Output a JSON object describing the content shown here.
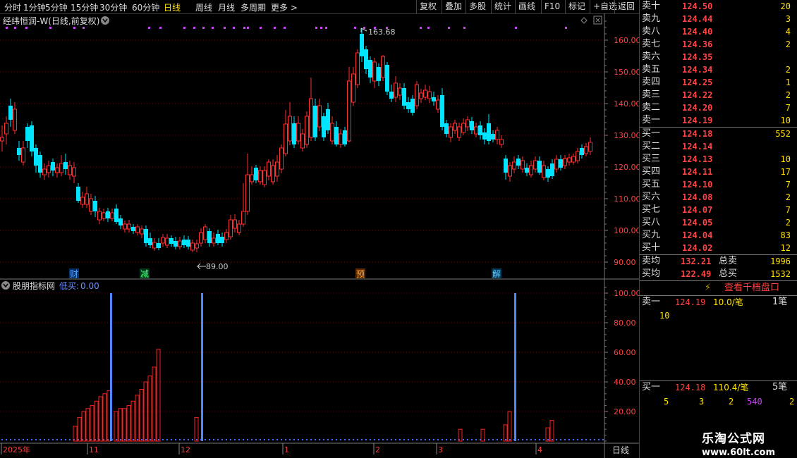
{
  "toolbar": {
    "periods": [
      "分时",
      "1分钟",
      "5分钟",
      "15分钟",
      "30分钟",
      "60分钟",
      "日线",
      "周线",
      "月线",
      "多周期",
      "更多 >"
    ],
    "active": "日线",
    "right_buttons": [
      "复权",
      "叠加",
      "多股",
      "统计",
      "画线",
      "F10",
      "标记",
      "+自选",
      "返回"
    ]
  },
  "chart_title": "经纬恒润-W(日线,前复权)",
  "price_axis": [
    "160.00",
    "150.00",
    "140.00",
    "130.00",
    "120.00",
    "110.00",
    "100.00",
    "90.00"
  ],
  "peak_label": "163.68",
  "low_label": "89.00",
  "event_markers": [
    "财",
    "减",
    "预",
    "解"
  ],
  "indicator": {
    "name": "股朋指标网",
    "label": "低买:",
    "value": "0.00"
  },
  "indicator_axis": [
    "100.00",
    "80.00",
    "60.00",
    "40.00",
    "20.00"
  ],
  "date_axis": [
    "2025年",
    "11",
    "12",
    "1",
    "2",
    "3",
    "4"
  ],
  "period_label": "日线",
  "colors": {
    "up": "#ff3030",
    "down": "#00e5ff",
    "signal": "#4f86ff",
    "bar": "#ff2020",
    "grid": "#5a1010"
  },
  "icons": [
    "collapse-icon",
    "settings-icon",
    "close-icon",
    "lightning-icon"
  ],
  "order_book": {
    "asks": [
      {
        "label": "卖十",
        "price": "124.50",
        "vol": "20"
      },
      {
        "label": "卖九",
        "price": "124.44",
        "vol": "3"
      },
      {
        "label": "卖八",
        "price": "124.40",
        "vol": "4"
      },
      {
        "label": "卖七",
        "price": "124.36",
        "vol": "2"
      },
      {
        "label": "卖六",
        "price": "124.35",
        "vol": ""
      },
      {
        "label": "卖五",
        "price": "124.34",
        "vol": "2"
      },
      {
        "label": "卖四",
        "price": "124.25",
        "vol": "1"
      },
      {
        "label": "卖三",
        "price": "124.22",
        "vol": "2"
      },
      {
        "label": "卖二",
        "price": "124.20",
        "vol": "7"
      },
      {
        "label": "卖一",
        "price": "124.19",
        "vol": "10"
      }
    ],
    "bids": [
      {
        "label": "买一",
        "price": "124.18",
        "vol": "552"
      },
      {
        "label": "买二",
        "price": "124.14",
        "vol": ""
      },
      {
        "label": "买三",
        "price": "124.13",
        "vol": "10"
      },
      {
        "label": "买四",
        "price": "124.11",
        "vol": "17"
      },
      {
        "label": "买五",
        "price": "124.10",
        "vol": "7"
      },
      {
        "label": "买六",
        "price": "124.08",
        "vol": "2"
      },
      {
        "label": "买七",
        "price": "124.07",
        "vol": "7"
      },
      {
        "label": "买八",
        "price": "124.05",
        "vol": "2"
      },
      {
        "label": "买九",
        "price": "124.04",
        "vol": "83"
      },
      {
        "label": "买十",
        "price": "124.02",
        "vol": "12"
      }
    ],
    "avg_sell": {
      "label": "卖均",
      "price": "132.21",
      "total_label": "总卖",
      "total": "1996"
    },
    "avg_buy": {
      "label": "买均",
      "price": "122.49",
      "total_label": "总买",
      "total": "1532"
    },
    "view_button": "查看千档盘口",
    "ask1": {
      "label": "卖一",
      "price": "124.19",
      "size": "10.0/笔",
      "count": "1笔",
      "orders": [
        "10"
      ]
    },
    "bid1": {
      "label": "买一",
      "price": "124.18",
      "size": "110.4/笔",
      "count": "5笔",
      "orders": [
        "5",
        "3",
        "2",
        "540",
        "2"
      ]
    }
  },
  "watermark": {
    "name": "乐淘公式网",
    "url": "www.60lt.com"
  }
}
